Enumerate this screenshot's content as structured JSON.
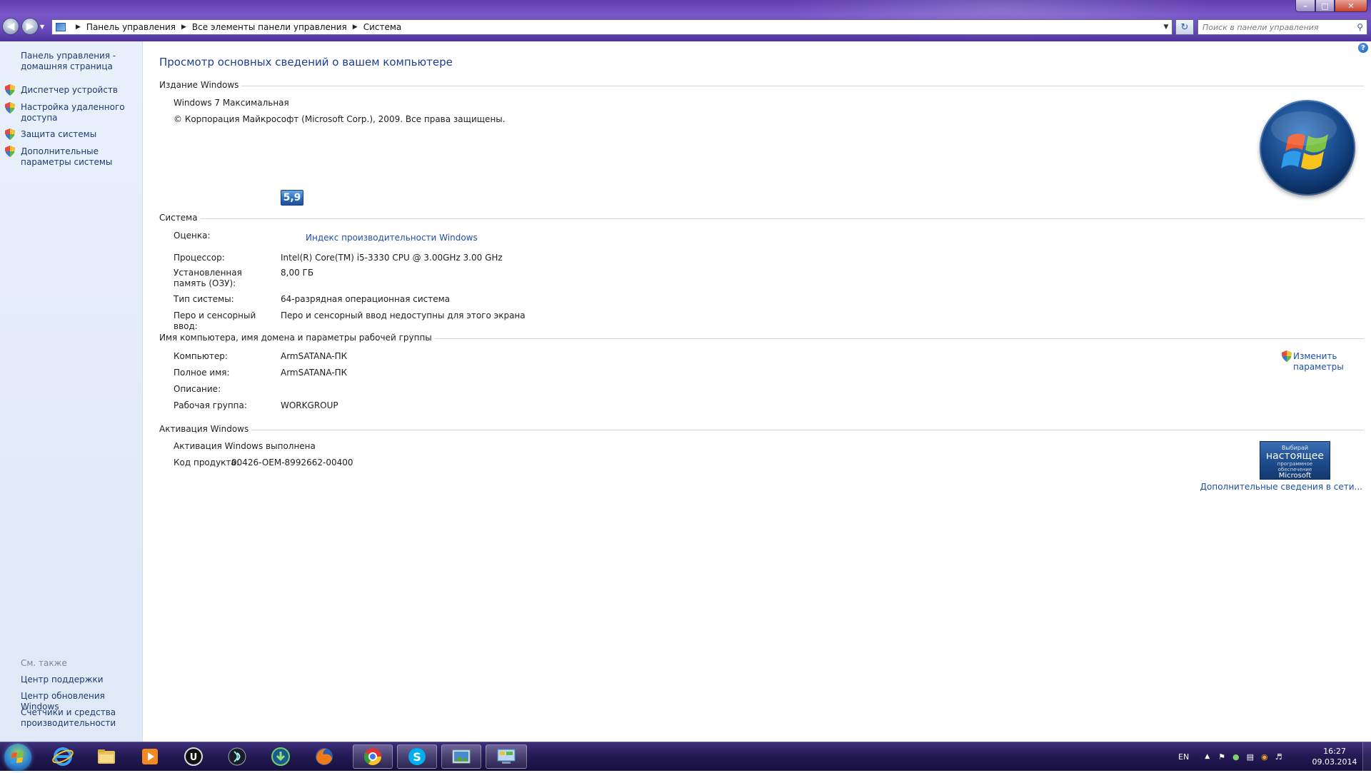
{
  "window": {
    "breadcrumb": [
      "Панель управления",
      "Все элементы панели управления",
      "Система"
    ],
    "search_placeholder": "Поиск в панели управления",
    "help": "?"
  },
  "sidebar": {
    "home": "Панель управления - домашняя страница",
    "tasks": [
      "Диспетчер устройств",
      "Настройка удаленного доступа",
      "Защита системы",
      "Дополнительные параметры системы"
    ],
    "see_also_title": "См. также",
    "see_also": [
      "Центр поддержки",
      "Центр обновления Windows",
      "Счетчики и средства производительности"
    ]
  },
  "main": {
    "title": "Просмотр основных сведений о вашем компьютере",
    "edition": {
      "header": "Издание Windows",
      "name": "Windows 7 Максимальная",
      "copyright": "© Корпорация Майкрософт (Microsoft Corp.), 2009. Все права защищены."
    },
    "system": {
      "header": "Система",
      "rating_label": "Оценка:",
      "rating_score": "5,9",
      "rating_link": "Индекс производительности Windows",
      "cpu_label": "Процессор:",
      "cpu_value": "Intel(R) Core(TM) i5-3330 CPU @ 3.00GHz   3.00 GHz",
      "ram_label": "Установленная память (ОЗУ):",
      "ram_value": "8,00 ГБ",
      "type_label": "Тип системы:",
      "type_value": "64-разрядная операционная система",
      "pen_label": "Перо и сенсорный ввод:",
      "pen_value": "Перо и сенсорный ввод недоступны для этого экрана"
    },
    "computer": {
      "header": "Имя компьютера, имя домена и параметры рабочей группы",
      "name_label": "Компьютер:",
      "name_value": "ArmSATANA-ПК",
      "full_label": "Полное имя:",
      "full_value": "ArmSATANA-ПК",
      "desc_label": "Описание:",
      "desc_value": "",
      "wg_label": "Рабочая группа:",
      "wg_value": "WORKGROUP",
      "change_link": "Изменить параметры"
    },
    "activation": {
      "header": "Активация Windows",
      "status": "Активация Windows выполнена",
      "key_label": "Код продукта:",
      "key_value": "00426-OEM-8992662-00400",
      "badge_line1": "Выбирай",
      "badge_line2": "настоящее",
      "badge_line3": "программное обеспечение",
      "badge_line4": "Microsoft",
      "more_link": "Дополнительные сведения в сети..."
    }
  },
  "taskbar": {
    "lang": "EN",
    "time": "16:27",
    "date": "09.03.2014"
  },
  "colors": {
    "link": "#1d4fa8",
    "title": "#1e3d8f",
    "sidebar_bg": "#e3ecf9",
    "taskbar": "#241a55"
  }
}
